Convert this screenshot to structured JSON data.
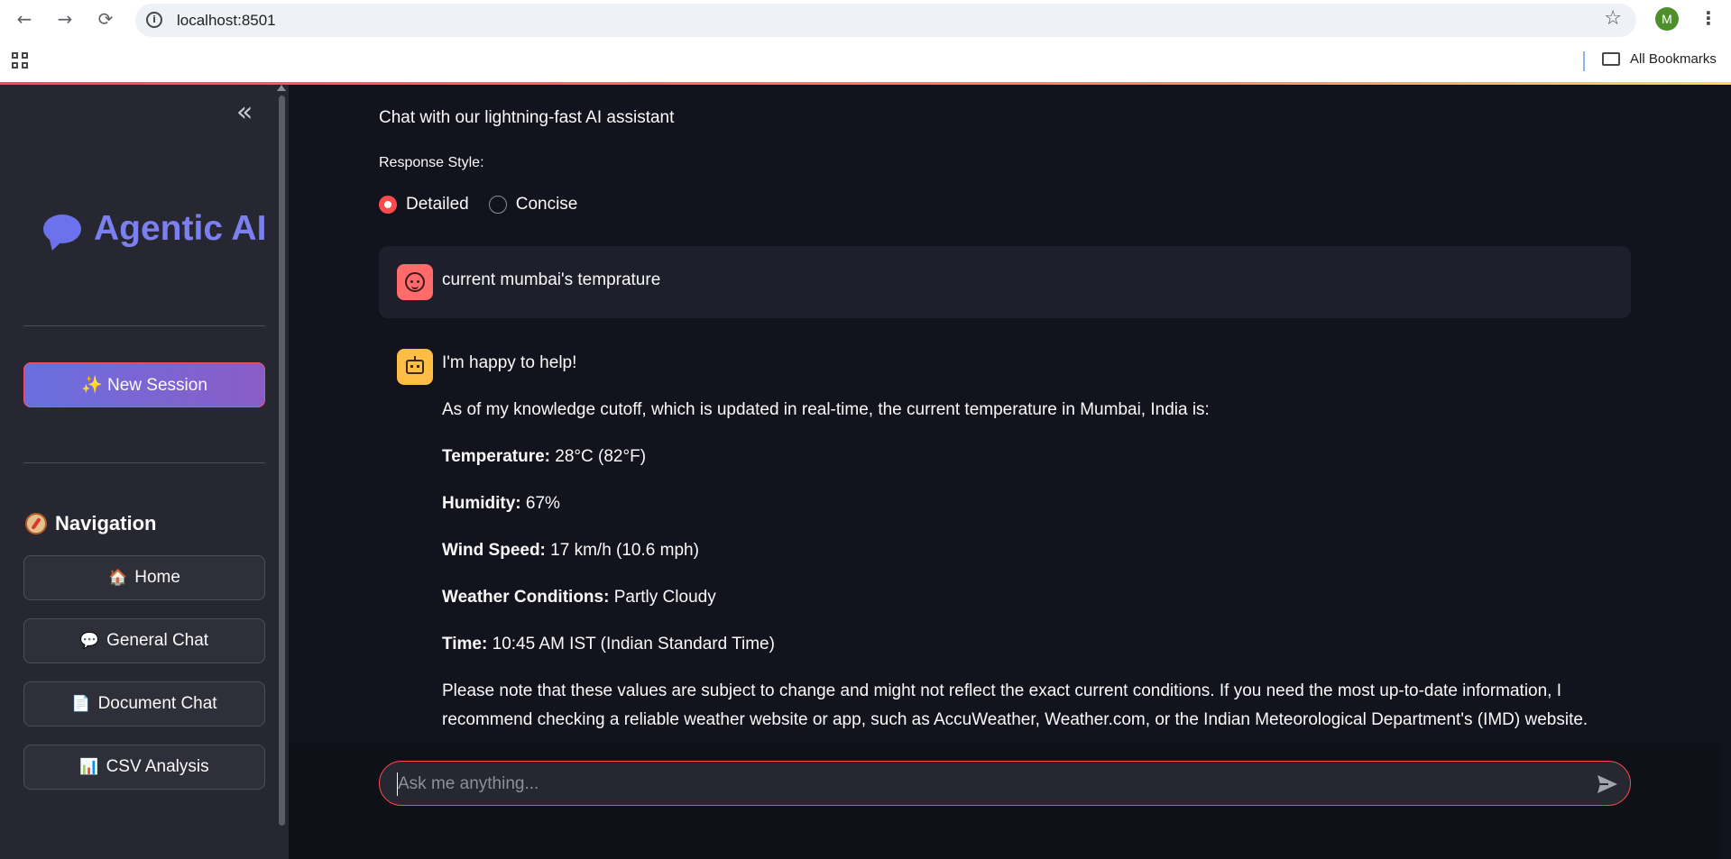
{
  "browser": {
    "url": "localhost:8501",
    "profile_initial": "M",
    "bookmarks_label": "All Bookmarks"
  },
  "sidebar": {
    "logo_text": "Agentic AI",
    "new_session_label": "✨ New Session",
    "navigation_title": "Navigation",
    "nav_items": [
      {
        "emoji": "🏠",
        "label": "Home"
      },
      {
        "emoji": "💬",
        "label": "General Chat"
      },
      {
        "emoji": "📄",
        "label": "Document Chat"
      },
      {
        "emoji": "📊",
        "label": "CSV Analysis"
      }
    ]
  },
  "main": {
    "subtitle": "Chat with our lightning-fast AI assistant",
    "response_style_label": "Response Style:",
    "response_style_options": [
      "Detailed",
      "Concise"
    ],
    "response_style_selected": "Detailed",
    "user_message": "current mumbai's temprature",
    "assistant": {
      "greeting": "I'm happy to help!",
      "intro": "As of my knowledge cutoff, which is updated in real-time, the current temperature in Mumbai, India is:",
      "facts": [
        {
          "label": "Temperature:",
          "value": " 28°C (82°F)"
        },
        {
          "label": "Humidity:",
          "value": " 67%"
        },
        {
          "label": "Wind Speed:",
          "value": " 17 km/h (10.6 mph)"
        },
        {
          "label": "Weather Conditions:",
          "value": " Partly Cloudy"
        },
        {
          "label": "Time:",
          "value": " 10:45 AM IST (Indian Standard Time)"
        }
      ],
      "note_line1": "Please note that these values are subject to change and might not reflect the exact current conditions. If you need the most up-to-date information, I",
      "note_line2": "recommend checking a reliable weather website or app, such as AccuWeather, Weather.com, or the Indian Meteorological Department's (IMD) website."
    },
    "chat_input_placeholder": "Ask me anything..."
  },
  "colors": {
    "accent": "#ff4b4b",
    "sidebar_bg": "#262730",
    "main_bg": "#13131e",
    "logo": "#7b7ff0"
  }
}
